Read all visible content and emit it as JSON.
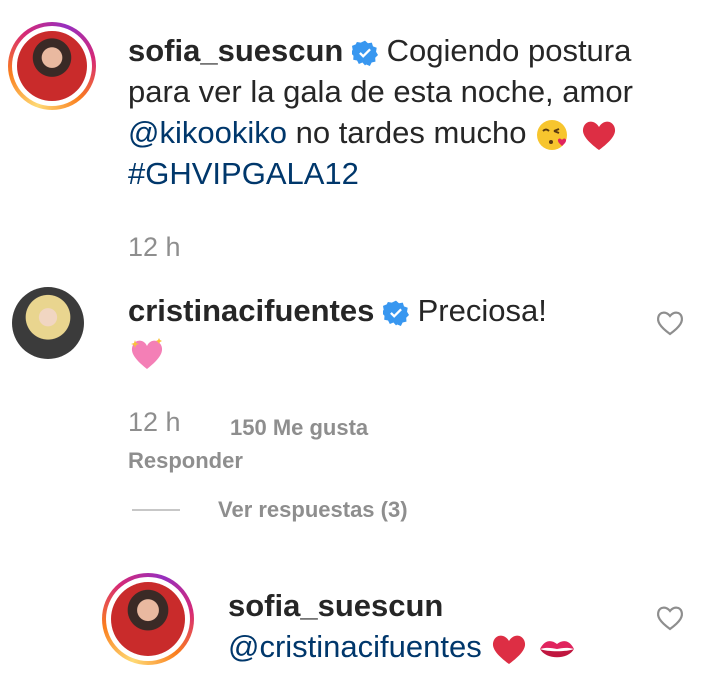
{
  "post": {
    "username": "sofia_suescun",
    "caption_lines": [
      "Cogiendo postura",
      "para ver la gala de esta noche, amor"
    ],
    "mention": "@kikookiko",
    "after_mention": "no tardes mucho",
    "hashtag": "#GHVIPGALA12",
    "time": "12 h"
  },
  "comment": {
    "username": "cristinacifuentes",
    "text": "Preciosa!",
    "time": "12 h",
    "likes": "150 Me gusta",
    "reply_label": "Responder",
    "view_replies": "Ver respuestas (3)"
  },
  "reply": {
    "username": "sofia_suescun",
    "mention": "@cristinacifuentes"
  },
  "icons": {
    "verified": "verified-badge-icon",
    "like": "heart-outline-icon",
    "kiss_face": "face-blowing-kiss-emoji",
    "red_heart": "red-heart-emoji",
    "sparkling_heart": "sparkling-heart-emoji",
    "kiss_mark": "kiss-mark-emoji"
  },
  "colors": {
    "link": "#00376b",
    "verified": "#3897f0",
    "muted": "#8e8e8e"
  }
}
